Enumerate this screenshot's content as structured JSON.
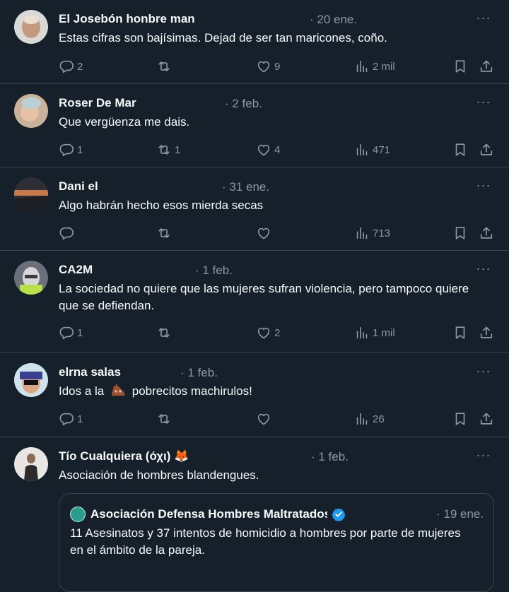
{
  "tweets": [
    {
      "name": "El Josebón honbre man",
      "date": "· 20 ene.",
      "text": "Estas cifras son bajísimas. Dejad de ser tan maricones, coño.",
      "replies": "2",
      "retweets": "",
      "likes": "9",
      "views": "2 mil"
    },
    {
      "name": "Roser De Mar",
      "date": "· 2 feb.",
      "text": "Que vergüenza me dais.",
      "replies": "1",
      "retweets": "1",
      "likes": "4",
      "views": "471"
    },
    {
      "name": "Dani el",
      "date": "· 31 ene.",
      "text": "Algo habrán hecho esos mierda secas",
      "replies": "",
      "retweets": "",
      "likes": "",
      "views": "713"
    },
    {
      "name": "CA2M",
      "date": "· 1 feb.",
      "text": "La sociedad no quiere que las mujeres sufran violencia, pero tampoco quiere que se defiendan.",
      "replies": "1",
      "retweets": "",
      "likes": "2",
      "views": "1 mil"
    },
    {
      "name": "elrna salas",
      "date": "· 1 feb.",
      "text_before": "Idos a la",
      "text_after": "pobrecitos machirulos!",
      "replies": "1",
      "retweets": "",
      "likes": "",
      "views": "26"
    },
    {
      "name": "Tío Cualquiera (όχι) 🦊",
      "date": "· 1 feb.",
      "text": "Asociación de hombres blandengues.",
      "quote": {
        "name": "Asociación Defensa Hombres Maltratados",
        "date": "· 19 ene.",
        "text": "11 Asesinatos y 37 intentos de homicidio a hombres por parte de mujeres en el ámbito de la pareja."
      }
    }
  ],
  "more_glyph": "···",
  "icons": {
    "reply": "reply-icon",
    "retweet": "retweet-icon",
    "like": "like-icon",
    "views": "views-icon",
    "bookmark": "bookmark-icon",
    "share": "share-icon",
    "verified": "verified-badge-icon",
    "emoji": "poop-emoji-icon"
  },
  "colors": {
    "background": "#15202b",
    "text": "#f7f9f9",
    "muted": "#8b98a5",
    "border": "#38444d",
    "verified": "#1d9bf0"
  }
}
